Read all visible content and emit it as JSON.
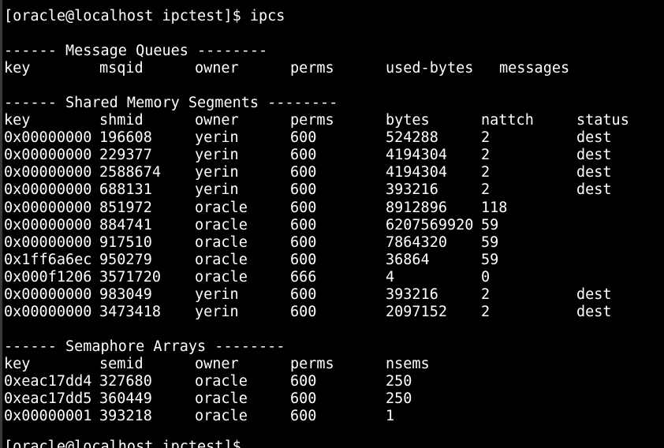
{
  "terminal": {
    "prompt_line": "[oracle@localhost ipctest]$ ipcs",
    "message_queues": {
      "header": "------ Message Queues --------",
      "columns": [
        "key",
        "msqid",
        "owner",
        "perms",
        "used-bytes",
        "messages"
      ]
    },
    "shared_memory": {
      "header": "------ Shared Memory Segments --------",
      "columns": [
        "key",
        "shmid",
        "owner",
        "perms",
        "bytes",
        "nattch",
        "status"
      ],
      "rows": [
        [
          "0x00000000",
          "196608",
          "yerin",
          "600",
          "524288",
          "2",
          "dest"
        ],
        [
          "0x00000000",
          "229377",
          "yerin",
          "600",
          "4194304",
          "2",
          "dest"
        ],
        [
          "0x00000000",
          "2588674",
          "yerin",
          "600",
          "4194304",
          "2",
          "dest"
        ],
        [
          "0x00000000",
          "688131",
          "yerin",
          "600",
          "393216",
          "2",
          "dest"
        ],
        [
          "0x00000000",
          "851972",
          "oracle",
          "600",
          "8912896",
          "118",
          ""
        ],
        [
          "0x00000000",
          "884741",
          "oracle",
          "600",
          "6207569920",
          "59",
          ""
        ],
        [
          "0x00000000",
          "917510",
          "oracle",
          "600",
          "7864320",
          "59",
          ""
        ],
        [
          "0x1ff6a6ec",
          "950279",
          "oracle",
          "600",
          "36864",
          "59",
          ""
        ],
        [
          "0x000f1206",
          "3571720",
          "oracle",
          "666",
          "4",
          "0",
          ""
        ],
        [
          "0x00000000",
          "983049",
          "yerin",
          "600",
          "393216",
          "2",
          "dest"
        ],
        [
          "0x00000000",
          "3473418",
          "yerin",
          "600",
          "2097152",
          "2",
          "dest"
        ]
      ]
    },
    "semaphores": {
      "header": "------ Semaphore Arrays --------",
      "columns": [
        "key",
        "semid",
        "owner",
        "perms",
        "nsems"
      ],
      "rows": [
        [
          "0xeac17dd4",
          "327680",
          "oracle",
          "600",
          "250"
        ],
        [
          "0xeac17dd5",
          "360449",
          "oracle",
          "600",
          "250"
        ],
        [
          "0x00000001",
          "393218",
          "oracle",
          "600",
          "1"
        ]
      ]
    },
    "next_prompt_partial": "[oracle@localhost ipctest]$ "
  },
  "colors": {
    "background": "#000000",
    "foreground": "#ffffff"
  }
}
